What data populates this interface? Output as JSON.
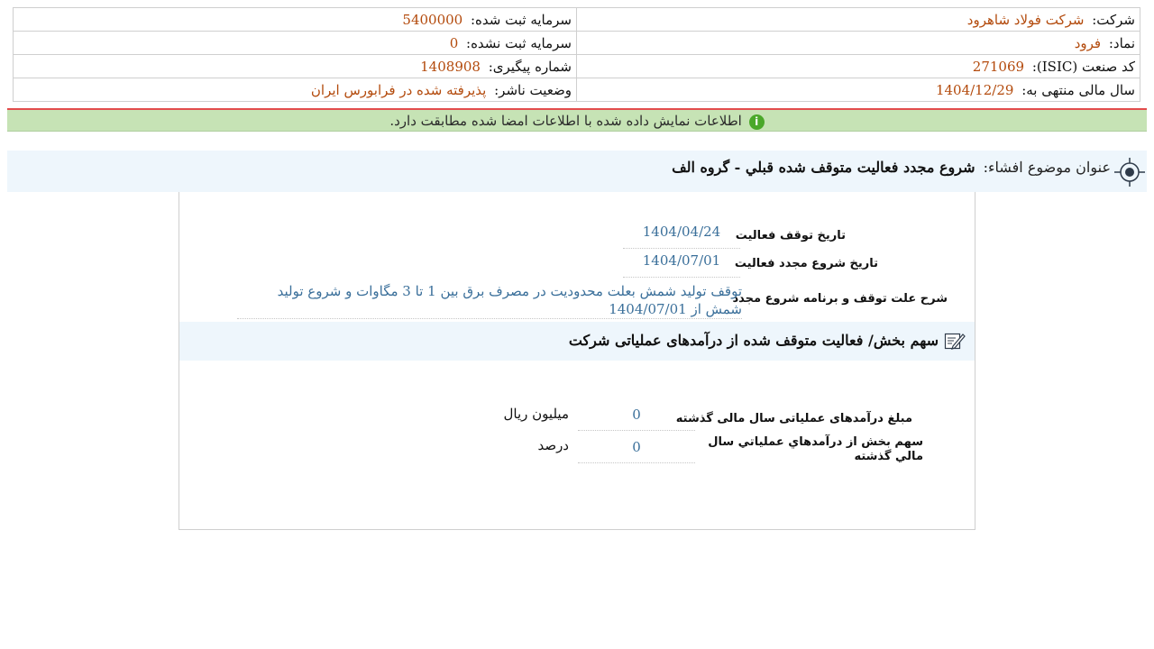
{
  "company_info": {
    "company": {
      "label": "شرکت:",
      "value": "شرکت فولاد شاهرود"
    },
    "registered_capital": {
      "label": "سرمایه ثبت شده:",
      "value": "5400000"
    },
    "symbol": {
      "label": "نماد:",
      "value": "فرود"
    },
    "unregistered_capital": {
      "label": "سرمایه ثبت نشده:",
      "value": "0"
    },
    "industry_code": {
      "label": "کد صنعت (ISIC):",
      "value": "271069"
    },
    "tracking_number": {
      "label": "شماره پیگیری:",
      "value": "1408908"
    },
    "fiscal_year_end": {
      "label": "سال مالی منتهی به:",
      "value": "1404/12/29"
    },
    "publisher_status": {
      "label": "وضعیت ناشر:",
      "value": "پذیرفته شده در فرابورس ایران"
    }
  },
  "notice": {
    "text": "اطلاعات نمایش داده شده با اطلاعات امضا شده مطابقت دارد.",
    "icon": "info-icon",
    "border_color": "#e24c4c",
    "bg_color": "#c6e3b5"
  },
  "subject": {
    "label": "عنوان موضوع افشاء:",
    "value": "شروع مجدد فعاليت متوقف شده قبلي - گروه الف"
  },
  "activity": {
    "stop_date": {
      "label": "تاریخ توقف فعالیت",
      "value": "1404/04/24"
    },
    "restart_date": {
      "label": "تاریخ شروع مجدد فعالیت",
      "value": "1404/07/01"
    },
    "reason": {
      "label": "شرح علت توقف و برنامه شروع مجدد",
      "value": "توقف تولید شمش بعلت محدودیت در مصرف برق بین 1 تا 3 مگاوات و شروع تولید شمش از 1404/07/01"
    }
  },
  "revenue_section": {
    "title": "سهم بخش/ فعالیت متوقف شده از درآمدهای عملیاتی شرکت",
    "operating_revenue": {
      "label": "مبلغ درآمدهای عملیاتی سال مالی گذشته",
      "value": "0",
      "unit": "میلیون ریال"
    },
    "share": {
      "label": "سهم بخش از درآمدهاي عملياتي سال مالي گذشته",
      "value": "0",
      "unit": "درصد"
    }
  },
  "colors": {
    "value_orange": "#b34a0c",
    "value_blue": "#3a6f9a",
    "header_bg": "#eef6fc"
  }
}
